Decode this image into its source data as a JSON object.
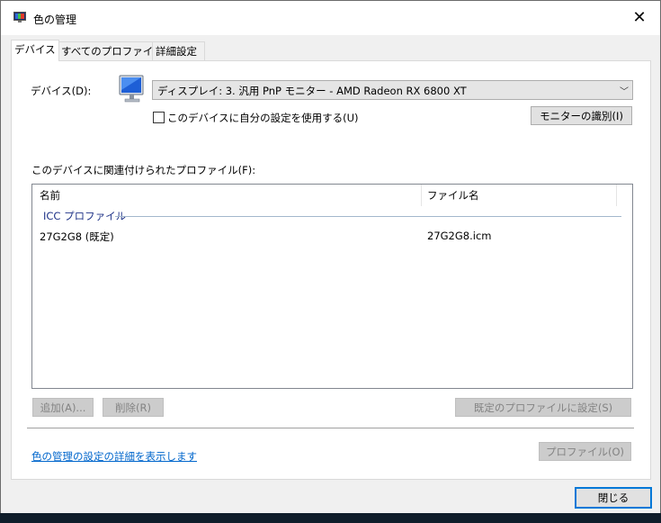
{
  "window": {
    "title": "色の管理",
    "close_glyph": "✕"
  },
  "tabs": [
    "デバイス",
    "すべてのプロファイル",
    "詳細設定"
  ],
  "device": {
    "label": "デバイス(D):",
    "selected": "ディスプレイ: 3. 汎用 PnP モニター - AMD Radeon RX 6800 XT",
    "use_my_settings_label": "このデバイスに自分の設定を使用する(U)",
    "use_my_settings_checked": false,
    "identify_button": "モニターの識別(I)"
  },
  "profiles": {
    "section_label": "このデバイスに関連付けられたプロファイル(F):",
    "columns": [
      "名前",
      "ファイル名"
    ],
    "group": "ICC プロファイル",
    "rows": [
      {
        "name": "27G2G8 (既定)",
        "file": "27G2G8.icm"
      }
    ]
  },
  "buttons": {
    "add": "追加(A)...",
    "remove": "削除(R)",
    "set_default": "既定のプロファイルに設定(S)",
    "profile": "プロファイル(O)",
    "close": "閉じる"
  },
  "link": "色の管理の設定の詳細を表示します",
  "colors": {
    "accent": "#0078d7",
    "link": "#0066cc",
    "group": "#1e3287"
  }
}
